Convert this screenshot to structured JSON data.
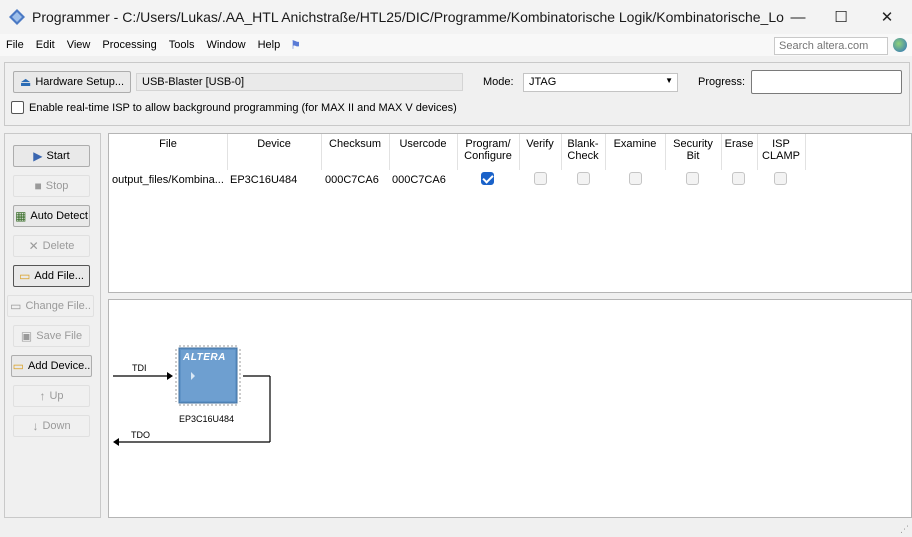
{
  "window": {
    "title": "Programmer - C:/Users/Lukas/.AA_HTL Anichstraße/HTL25/DIC/Programme/Kombinatorische Logik/Kombinatorische_Logik - Kom...",
    "minimize": "—",
    "maximize": "☐",
    "close": "✕"
  },
  "menu": {
    "items": [
      "File",
      "Edit",
      "View",
      "Processing",
      "Tools",
      "Window",
      "Help"
    ],
    "search_placeholder": "Search altera.com"
  },
  "toolbar": {
    "hardware_setup_label": "Hardware Setup...",
    "hardware_value": "USB-Blaster [USB-0]",
    "mode_label": "Mode:",
    "mode_value": "JTAG",
    "progress_label": "Progress:",
    "isp_label": "Enable real-time ISP to allow background programming (for MAX II and MAX V devices)",
    "isp_checked": false
  },
  "side_buttons": {
    "start": "Start",
    "stop": "Stop",
    "auto_detect": "Auto Detect",
    "delete": "Delete",
    "add_file": "Add File...",
    "change_file": "Change File..",
    "save_file": "Save File",
    "add_device": "Add Device..",
    "up": "Up",
    "down": "Down"
  },
  "table": {
    "headers": {
      "file": "File",
      "device": "Device",
      "checksum": "Checksum",
      "usercode": "Usercode",
      "program_1": "Program/",
      "program_2": "Configure",
      "verify": "Verify",
      "blank_1": "Blank-",
      "blank_2": "Check",
      "examine": "Examine",
      "security_1": "Security",
      "security_2": "Bit",
      "erase": "Erase",
      "isp_1": "ISP",
      "isp_2": "CLAMP"
    },
    "row": {
      "file": "output_files/Kombina...",
      "device": "EP3C16U484",
      "checksum": "000C7CA6",
      "usercode": "000C7CA6",
      "program": true,
      "verify": false,
      "blank_check": false,
      "examine": false,
      "security_bit": false,
      "erase": false,
      "isp_clamp": false
    }
  },
  "diagram": {
    "tdi": "TDI",
    "tdo": "TDO",
    "chip_logo": "ALTERA",
    "chip_name": "EP3C16U484"
  },
  "colors": {
    "accent": "#1a62c9",
    "chip_blue": "#5f93c7"
  }
}
